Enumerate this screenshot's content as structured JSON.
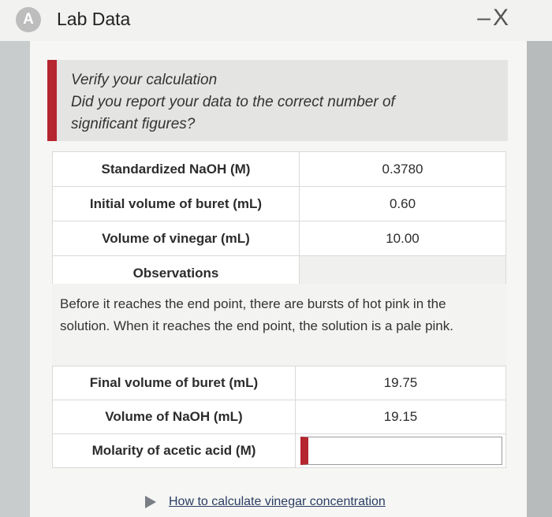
{
  "window": {
    "title": "Lab Data",
    "app_icon_letter": "A",
    "controls": {
      "minimize": "–",
      "close": "X"
    }
  },
  "verify": {
    "line1": "Verify your calculation",
    "line2": "Did you report your data to the correct number of",
    "line3": "significant figures?"
  },
  "table1": [
    {
      "label": "Standardized NaOH (M)",
      "value": "0.3780"
    },
    {
      "label": "Initial volume of buret (mL)",
      "value": "0.60"
    },
    {
      "label": "Volume of vinegar (mL)",
      "value": "10.00"
    }
  ],
  "observations": {
    "label": "Observations",
    "text": "Before it reaches the end point, there are bursts of hot pink in the solution. When it reaches the end point, the solution is a pale pink."
  },
  "table2": [
    {
      "label": "Final volume of buret (mL)",
      "value": "19.75"
    },
    {
      "label": "Volume of NaOH (mL)",
      "value": "19.15"
    },
    {
      "label": "Molarity of acetic acid (M)",
      "value": ""
    }
  ],
  "colors": {
    "accent_red": "#b5262f",
    "link": "#2a3d63"
  },
  "help": {
    "link_text": "How to calculate vinegar concentration"
  }
}
